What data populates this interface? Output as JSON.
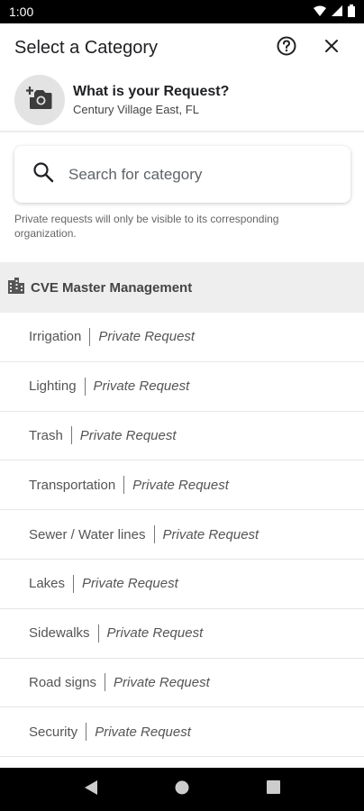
{
  "status_bar": {
    "time": "1:00"
  },
  "header": {
    "title": "Select a Category"
  },
  "request": {
    "title": "What is your Request?",
    "location": "Century Village East, FL"
  },
  "search": {
    "placeholder": "Search for category"
  },
  "note": "Private requests will only be visible to its corresponding organization.",
  "organization": {
    "name": "CVE Master Management"
  },
  "categories": [
    {
      "name": "Irrigation",
      "tag": "Private Request"
    },
    {
      "name": "Lighting",
      "tag": "Private Request"
    },
    {
      "name": "Trash",
      "tag": "Private Request"
    },
    {
      "name": "Transportation",
      "tag": "Private Request"
    },
    {
      "name": "Sewer / Water lines",
      "tag": "Private Request"
    },
    {
      "name": "Lakes",
      "tag": "Private Request"
    },
    {
      "name": "Sidewalks",
      "tag": "Private Request"
    },
    {
      "name": "Road signs",
      "tag": "Private Request"
    },
    {
      "name": "Security",
      "tag": "Private Request"
    }
  ],
  "icons": {
    "wifi": "wifi-icon",
    "signal": "signal-icon",
    "battery": "battery-icon",
    "help": "help-icon",
    "close": "close-icon",
    "camera": "add-photo-icon",
    "search": "search-icon",
    "org": "building-icon",
    "back": "back-icon",
    "home": "home-icon",
    "recents": "recents-icon"
  }
}
